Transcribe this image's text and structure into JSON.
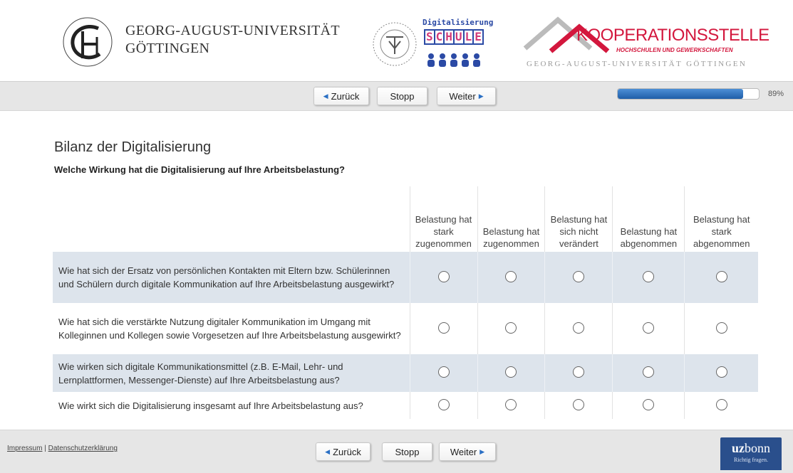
{
  "header": {
    "university_line1": "GEORG-AUGUST-UNIVERSITÄT",
    "university_line2": "GÖTTINGEN",
    "digi_title": "Digitalisierung",
    "digi_schule": [
      "S",
      "C",
      "H",
      "U",
      "L",
      "E"
    ],
    "koop_title": "KOOPERATIONSSTELLE",
    "koop_subtitle": "HOCHSCHULEN UND GEWERKSCHAFTEN",
    "koop_university": "GEORG-AUGUST-UNIVERSITÄT GÖTTINGEN",
    "brand_color": "#d3173d",
    "digi_color": "#2b4aa5"
  },
  "nav": {
    "back_label": "Zurück",
    "stop_label": "Stopp",
    "next_label": "Weiter",
    "progress_percent_label": "89%",
    "progress_value": 0.89
  },
  "survey": {
    "title": "Bilanz der Digitalisierung",
    "question": "Welche Wirkung hat die Digitalisierung auf Ihre Arbeitsbelastung?",
    "columns": [
      "Belastung hat stark zugenommen",
      "Belastung hat zugenommen",
      "Belastung hat sich nicht verändert",
      "Belastung hat abgenommen",
      "Belastung hat stark abgenommen"
    ],
    "rows": [
      "Wie hat sich der Ersatz von persönlichen Kontakten mit Eltern bzw. Schülerinnen und Schülern durch digitale Kommunikation auf Ihre Arbeitsbelastung ausgewirkt?",
      "Wie hat sich die verstärkte Nutzung digitaler Kommunikation im Umgang mit Kolleginnen und Kollegen sowie Vorgesetzen auf Ihre Arbeitsbelastung ausgewirkt?",
      "Wie wirken sich digitale Kommunikationsmittel (z.B. E-Mail, Lehr- und Lernplattformen, Messenger-Dienste) auf Ihre Arbeitsbelastung aus?",
      "Wie wirkt sich die Digitalisierung insgesamt auf Ihre Arbeitsbelastung aus?"
    ]
  },
  "footer": {
    "impressum": "Impressum",
    "separator": "|",
    "privacy": "Datenschutzerklärung",
    "uzbonn_main_bold": "uz",
    "uzbonn_main": "bonn",
    "uzbonn_tagline": "Richtig fragen."
  }
}
